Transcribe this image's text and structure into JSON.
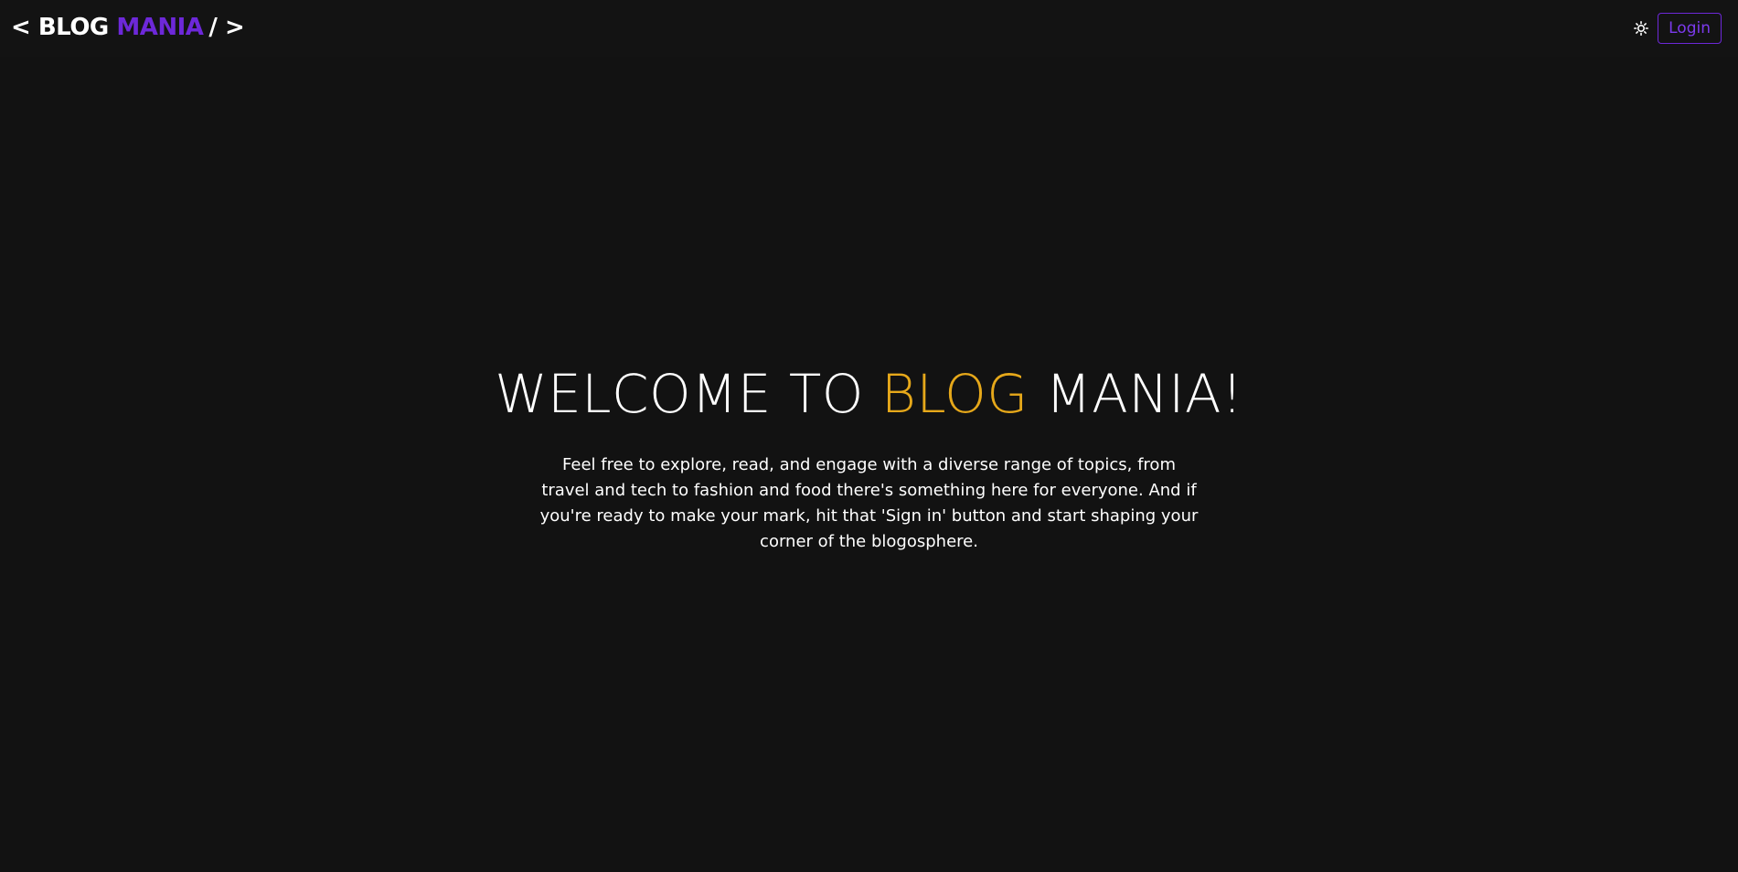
{
  "navbar": {
    "logo": {
      "open_bracket": "<",
      "word1": "BLOG",
      "word2": "MANIA",
      "close": "/ >"
    },
    "theme_toggle_icon": "sun-icon",
    "login_label": "Login"
  },
  "hero": {
    "title_part1": "WELCOME TO ",
    "title_accent": "BLOG",
    "title_part2": " MANIA!",
    "description": "Feel free to explore, read, and engage with a diverse range of topics, from travel and tech to fashion and food there's something here for everyone. And if you're ready to make your mark, hit that 'Sign in' button and start shaping your corner of the blogosphere."
  },
  "colors": {
    "background": "#121212",
    "brand_purple": "#6d28d9",
    "accent_gold": "#e6a81a",
    "text": "#ffffff"
  }
}
